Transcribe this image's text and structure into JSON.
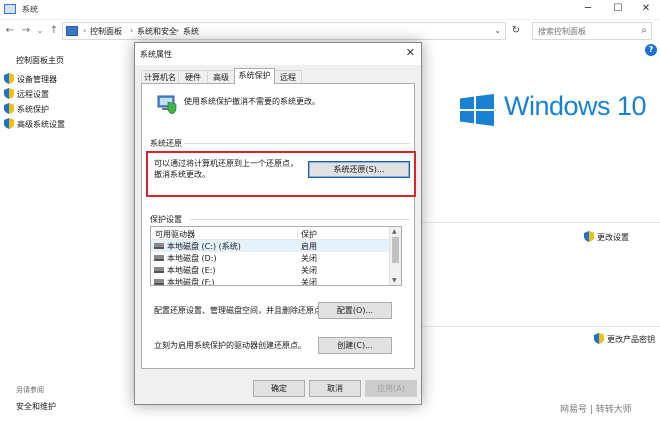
{
  "window": {
    "title": "系统"
  },
  "nav": {
    "breadcrumbs": [
      "控制面板",
      "系统和安全",
      "系统"
    ],
    "search_placeholder": "搜索控制面板"
  },
  "sidebar": {
    "home": "控制面板主页",
    "items": [
      {
        "label": "设备管理器"
      },
      {
        "label": "远程设置"
      },
      {
        "label": "系统保护"
      },
      {
        "label": "高级系统设置"
      }
    ],
    "see_also": "另请参阅",
    "see_also_link": "安全和维护"
  },
  "main": {
    "windows_brand": "Windows 10",
    "change_settings": "更改设置",
    "change_key": "更改产品密钥"
  },
  "dialog": {
    "title": "系统属性",
    "tabs": [
      {
        "label": "计算机名"
      },
      {
        "label": "硬件"
      },
      {
        "label": "高级"
      },
      {
        "label": "系统保护"
      },
      {
        "label": "远程"
      }
    ],
    "active_tab": 3,
    "protect_desc": "使用系统保护撤消不需要的系统更改。",
    "restore_group": "系统还原",
    "restore_desc": "可以通过将计算机还原到上一个还原点，撤消系统更改。",
    "restore_button": "系统还原(S)...",
    "protect_group": "保护设置",
    "table": {
      "headers": [
        "可用驱动器",
        "保护"
      ],
      "rows": [
        {
          "drive": "本地磁盘 (C:) (系统)",
          "status": "启用"
        },
        {
          "drive": "本地磁盘 (D:)",
          "status": "关闭"
        },
        {
          "drive": "本地磁盘 (E:)",
          "status": "关闭"
        },
        {
          "drive": "本地磁盘 (F:)",
          "status": "关闭"
        }
      ]
    },
    "config_desc": "配置还原设置、管理磁盘空间，并且删除还原点。",
    "config_button": "配置(O)...",
    "create_desc": "立刻为启用系统保护的驱动器创建还原点。",
    "create_button": "创建(C)...",
    "ok": "确定",
    "cancel": "取消",
    "apply": "应用(A)"
  },
  "watermark": "网易号 | 转转大师",
  "colors": {
    "accent": "#1a80d2",
    "highlight_border": "#d62828",
    "shield_blue": "#1e6fd6",
    "shield_yellow": "#f2c200"
  }
}
